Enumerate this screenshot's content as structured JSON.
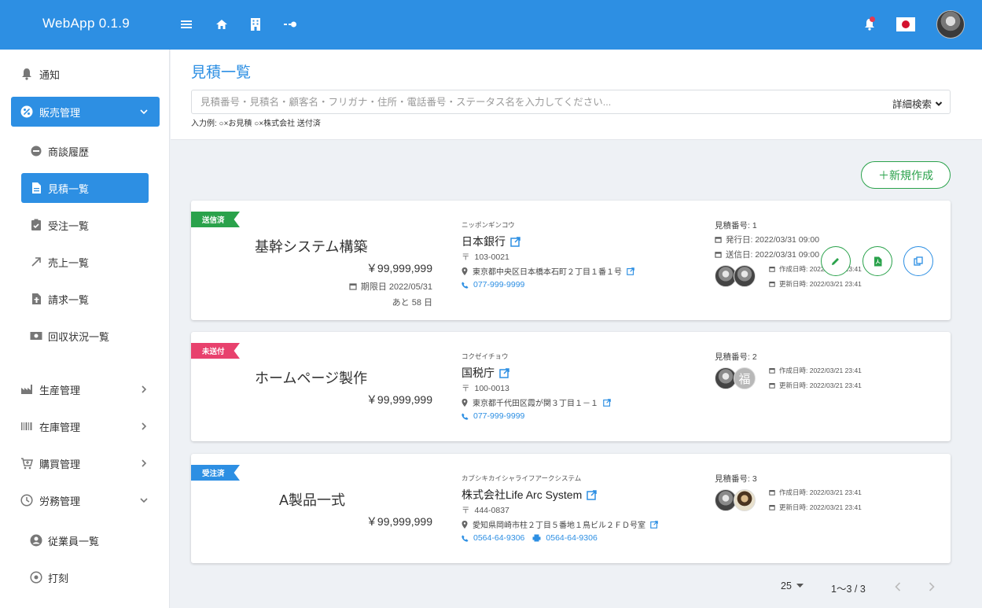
{
  "app": {
    "title": "WebApp 0.1.9"
  },
  "appbar_icons": [
    "menu-icon",
    "home-icon",
    "building-icon",
    "key-icon",
    "bell-icon",
    "japan-flag",
    "user-avatar"
  ],
  "sidebar": {
    "notice": "通知",
    "sales": "販売管理",
    "sales_items": [
      "商談履歴",
      "見積一覧",
      "受注一覧",
      "売上一覧",
      "請求一覧",
      "回収状況一覧"
    ],
    "production": "生産管理",
    "inventory": "在庫管理",
    "purchase": "購買管理",
    "labor": "労務管理",
    "labor_items": [
      "従業員一覧",
      "打刻"
    ]
  },
  "page": {
    "title": "見積一覧",
    "search_placeholder": "見積番号・見積名・顧客名・フリガナ・住所・電話番号・ステータス名を入力してください...",
    "advanced_search": "詳細検索",
    "hint": "入力例: ○×お見積 ○×株式会社 送付済",
    "new_button": "＋新規作成"
  },
  "colors": {
    "primary": "#2d8fe3",
    "sent": "#2aa24b",
    "unsent": "#e8416d",
    "ordered": "#2d8fe3"
  },
  "quotes": [
    {
      "status": "送信済",
      "title": "基幹システム構築",
      "amount": "￥99,999,999",
      "due": "期限日 2022/05/31",
      "remaining": "あと 58 日",
      "kana": "ニッポンギンコウ",
      "customer": "日本銀行",
      "zip": "103-0021",
      "address": "東京都中央区日本橋本石町２丁目１番１号",
      "tel": "077-999-9999",
      "number": "見積番号: 1",
      "issued": "発行日: 2022/03/31 09:00",
      "sent": "送信日: 2022/03/31 09:00",
      "created": "作成日時: 2022/03/21 23:41",
      "updated": "更新日時: 2022/03/21 23:41"
    },
    {
      "status": "未送付",
      "title": "ホームページ製作",
      "amount": "￥99,999,999",
      "kana": "コクゼイチョウ",
      "customer": "国税庁",
      "zip": "100-0013",
      "address": "東京都千代田区霞が関３丁目１－１",
      "tel": "077-999-9999",
      "number": "見積番号: 2",
      "avatar_char": "福",
      "created": "作成日時: 2022/03/21 23:41",
      "updated": "更新日時: 2022/03/21 23:41"
    },
    {
      "status": "受注済",
      "title": "A製品一式",
      "amount": "￥99,999,999",
      "kana": "カブシキカイシャライフアークシステム",
      "customer": "株式会社Life Arc System",
      "zip": "444-0837",
      "address": "愛知県岡崎市柱２丁目５番地１鳥ビル２ＦＤ号室",
      "tel": "0564-64-9306",
      "fax": "0564-64-9306",
      "number": "見積番号: 3",
      "created": "作成日時: 2022/03/21 23:41",
      "updated": "更新日時: 2022/03/21 23:41"
    }
  ],
  "pagination": {
    "per_page": "25",
    "range": "1〜3 / 3"
  }
}
